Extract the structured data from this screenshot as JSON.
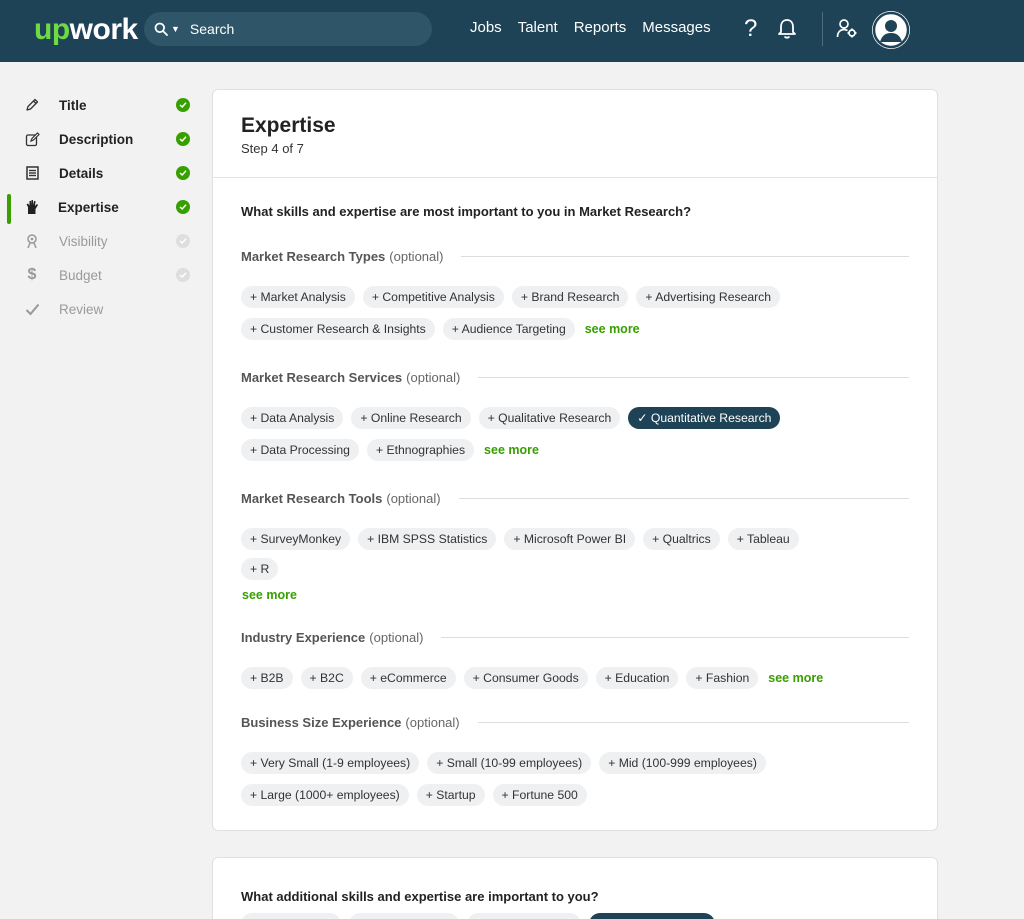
{
  "brand": {
    "up": "up",
    "work": "work"
  },
  "search": {
    "placeholder": "Search"
  },
  "nav": [
    "Jobs",
    "Talent",
    "Reports",
    "Messages"
  ],
  "help_label": "?",
  "colors": {
    "navy": "#1e4356",
    "green": "#37a000",
    "pill": "#eef0f2"
  },
  "sidebar": {
    "steps": [
      {
        "label": "Title",
        "icon": "pencil-icon",
        "status": "done"
      },
      {
        "label": "Description",
        "icon": "edit-icon",
        "status": "done"
      },
      {
        "label": "Details",
        "icon": "list-icon",
        "status": "done"
      },
      {
        "label": "Expertise",
        "icon": "hand-icon",
        "status": "done",
        "active": true
      },
      {
        "label": "Visibility",
        "icon": "visibility-icon",
        "status": "pending"
      },
      {
        "label": "Budget",
        "icon": "dollar-icon",
        "status": "pending"
      },
      {
        "label": "Review",
        "icon": "checkmark-icon",
        "status": "pending"
      }
    ]
  },
  "card": {
    "title": "Expertise",
    "step": "Step 4 of 7",
    "question": "What skills and expertise are most important to you in Market Research?",
    "sections": [
      {
        "title": "Market Research Types",
        "optional": "(optional)",
        "pills": [
          "+ Market Analysis",
          "+ Competitive Analysis",
          "+ Brand Research",
          "+ Advertising Research",
          "+ Customer Research & Insights",
          "+ Audience Targeting"
        ],
        "see_more": "see more"
      },
      {
        "title": "Market Research Services",
        "optional": "(optional)",
        "pills": [
          "+ Data Analysis",
          "+ Online Research",
          "+ Qualitative Research",
          "✓ Quantitative Research",
          "+ Data Processing",
          "+ Ethnographies"
        ],
        "selected_index": 3,
        "see_more": "see more"
      },
      {
        "title": "Market Research Tools",
        "optional": "(optional)",
        "pills": [
          "+ SurveyMonkey",
          "+ IBM SPSS Statistics",
          "+ Microsoft Power BI",
          "+ Qualtrics",
          "+ Tableau",
          "+ R"
        ],
        "see_more": "see more"
      },
      {
        "title": "Industry Experience",
        "optional": "(optional)",
        "pills": [
          "+ B2B",
          "+ B2C",
          "+ eCommerce",
          "+ Consumer Goods",
          "+ Education",
          "+ Fashion"
        ],
        "see_more": "see more"
      },
      {
        "title": "Business Size Experience",
        "optional": "(optional)",
        "pills": [
          "+ Very Small (1-9 employees)",
          "+ Small (10-99 employees)",
          "+ Mid (100-999 employees)",
          "+ Large (1000+ employees)",
          "+ Startup",
          "+ Fortune 500"
        ],
        "see_more": ""
      }
    ]
  },
  "card2": {
    "question": "What additional skills and expertise are important to you?"
  }
}
